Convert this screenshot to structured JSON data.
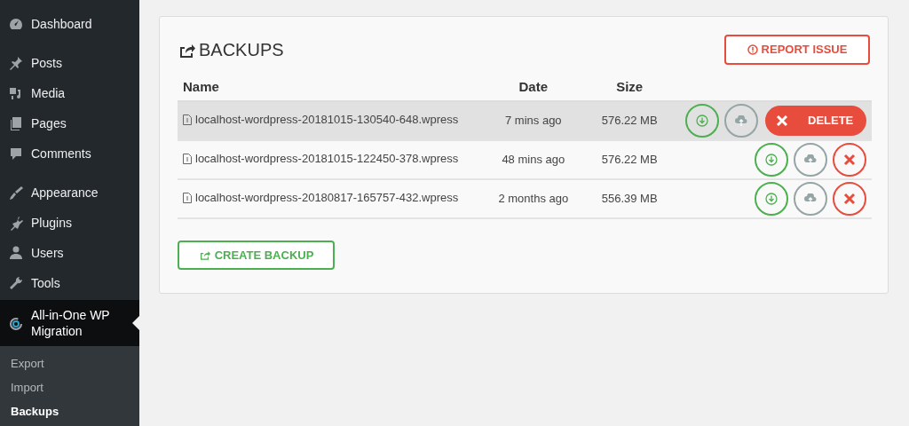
{
  "sidebar": {
    "groups": [
      {
        "items": [
          {
            "label": "Dashboard",
            "selected": false
          }
        ]
      },
      {
        "items": [
          {
            "label": "Posts",
            "selected": false
          },
          {
            "label": "Media",
            "selected": false
          },
          {
            "label": "Pages",
            "selected": false
          },
          {
            "label": "Comments",
            "selected": false
          }
        ]
      },
      {
        "items": [
          {
            "label": "Appearance",
            "selected": false
          },
          {
            "label": "Plugins",
            "selected": false
          },
          {
            "label": "Users",
            "selected": false
          },
          {
            "label": "Tools",
            "selected": false
          },
          {
            "label": "All-in-One WP Migration",
            "selected": true
          }
        ]
      }
    ],
    "submenu": [
      {
        "label": "Export",
        "selected": false
      },
      {
        "label": "Import",
        "selected": false
      },
      {
        "label": "Backups",
        "selected": true
      }
    ]
  },
  "panel": {
    "title": "BACKUPS",
    "report_button": "REPORT ISSUE",
    "columns": [
      "Name",
      "Date",
      "Size"
    ],
    "rows": [
      {
        "name": "localhost-wordpress-20181015-130540-648.wpress",
        "date": "7 mins ago",
        "size": "576.22 MB",
        "selected": true,
        "delete_label": "DELETE"
      },
      {
        "name": "localhost-wordpress-20181015-122450-378.wpress",
        "date": "48 mins ago",
        "size": "576.22 MB",
        "selected": false
      },
      {
        "name": "localhost-wordpress-20180817-165757-432.wpress",
        "date": "2 months ago",
        "size": "556.39 MB",
        "selected": false
      }
    ],
    "create_button": "CREATE BACKUP"
  }
}
